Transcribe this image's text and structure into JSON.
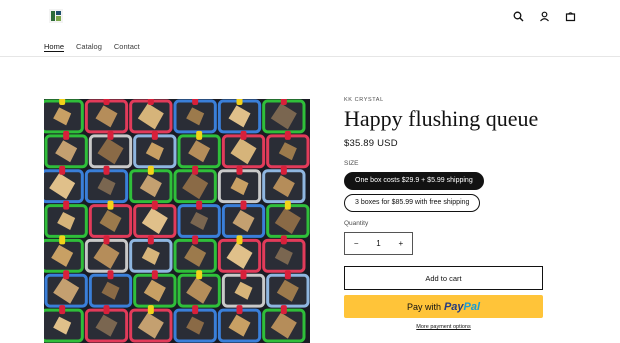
{
  "header": {
    "logo_icon": "shop-logo-icon",
    "nav": [
      {
        "label": "Home",
        "active": true
      },
      {
        "label": "Catalog",
        "active": false
      },
      {
        "label": "Contact",
        "active": false
      }
    ],
    "icons": [
      "search-icon",
      "account-icon",
      "cart-icon"
    ]
  },
  "product": {
    "vendor": "KK CRYSTAL",
    "title": "Happy flushing queue",
    "price": "$35.89 USD",
    "option_label": "SIZE",
    "options": [
      {
        "label": "One box costs $29.9 + $5.99 shipping",
        "selected": true
      },
      {
        "label": "3 boxes for $85.99 with free shipping",
        "selected": false
      }
    ],
    "quantity_label": "Quantity",
    "quantity": "1",
    "qty_minus": "−",
    "qty_plus": "+",
    "add_to_cart": "Add to cart",
    "paypal": {
      "prefix": "Pay with",
      "brand_a": "Pay",
      "brand_b": "Pal"
    },
    "more_payment": "More payment options"
  },
  "colors": {
    "accent": "#121212",
    "paypal_yellow": "#ffc439"
  }
}
